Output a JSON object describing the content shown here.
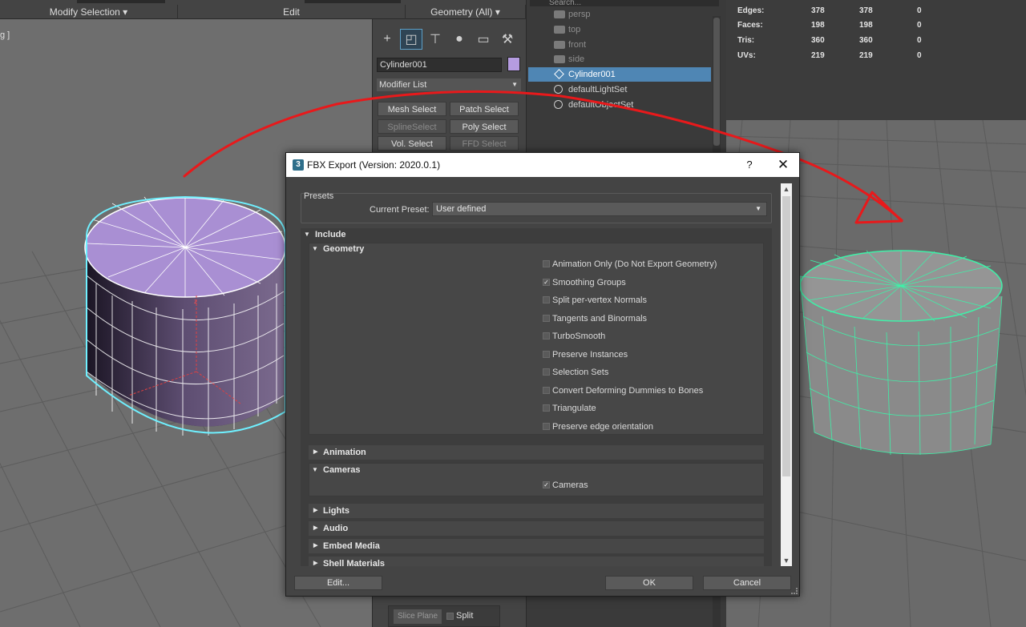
{
  "topbar": {
    "modify_selection": "Modify Selection ▾",
    "edit": "Edit",
    "geometry_all": "Geometry (All) ▾"
  },
  "viewport_left": {
    "label": "g ]"
  },
  "command_panel": {
    "tabs": [
      "create-icon",
      "modify-icon",
      "hierarchy-icon",
      "motion-icon",
      "display-icon",
      "utilities-icon"
    ],
    "object_name": "Cylinder001",
    "object_color": "#b59ce0",
    "modifier_list": "Modifier List",
    "buttons": {
      "mesh_select": "Mesh Select",
      "patch_select": "Patch Select",
      "spline_select": "SplineSelect",
      "poly_select": "Poly Select",
      "vol_select": "Vol. Select",
      "ffd_select": "FFD Select"
    },
    "bottom": {
      "slice_plane": "Slice Plane",
      "split": "Split"
    }
  },
  "explorer": {
    "search_placeholder": "Search...",
    "items": [
      {
        "label": "persp",
        "icon": "camera-icon"
      },
      {
        "label": "top",
        "icon": "camera-icon"
      },
      {
        "label": "front",
        "icon": "camera-icon"
      },
      {
        "label": "side",
        "icon": "camera-icon"
      },
      {
        "label": "Cylinder001",
        "icon": "mesh-icon"
      },
      {
        "label": "defaultLightSet",
        "icon": "set-icon"
      },
      {
        "label": "defaultObjectSet",
        "icon": "set-icon"
      }
    ]
  },
  "stats": {
    "rows": [
      {
        "label": "Edges:",
        "v1": "378",
        "v2": "378",
        "v3": "0"
      },
      {
        "label": "Faces:",
        "v1": "198",
        "v2": "198",
        "v3": "0"
      },
      {
        "label": "Tris:",
        "v1": "360",
        "v2": "360",
        "v3": "0"
      },
      {
        "label": "UVs:",
        "v1": "219",
        "v2": "219",
        "v3": "0"
      }
    ]
  },
  "dialog": {
    "title": "FBX Export (Version: 2020.0.1)",
    "help": "?",
    "close": "✕",
    "presets_title": "Presets",
    "current_preset_label": "Current Preset:",
    "current_preset_value": "User defined",
    "include": "Include",
    "geometry": "Geometry",
    "geometry_options": [
      {
        "label": "Animation Only (Do Not Export Geometry)",
        "checked": false
      },
      {
        "label": "Smoothing Groups",
        "checked": true
      },
      {
        "label": "Split per-vertex Normals",
        "checked": false
      },
      {
        "label": "Tangents and Binormals",
        "checked": false
      },
      {
        "label": "TurboSmooth",
        "checked": false
      },
      {
        "label": "Preserve Instances",
        "checked": false
      },
      {
        "label": "Selection Sets",
        "checked": false
      },
      {
        "label": "Convert Deforming Dummies to Bones",
        "checked": false
      },
      {
        "label": "Triangulate",
        "checked": false
      },
      {
        "label": "Preserve edge orientation",
        "checked": false
      }
    ],
    "animation": "Animation",
    "cameras": "Cameras",
    "cameras_option": {
      "label": "Cameras",
      "checked": true
    },
    "lights": "Lights",
    "audio": "Audio",
    "embed_media": "Embed Media",
    "shell_materials": "Shell Materials",
    "edit_button": "Edit...",
    "ok_button": "OK",
    "cancel_button": "Cancel"
  },
  "colors": {
    "arrow": "#e8191b",
    "selection_wire": "#40e0c8",
    "explorer_selected": "#4f86b4"
  }
}
